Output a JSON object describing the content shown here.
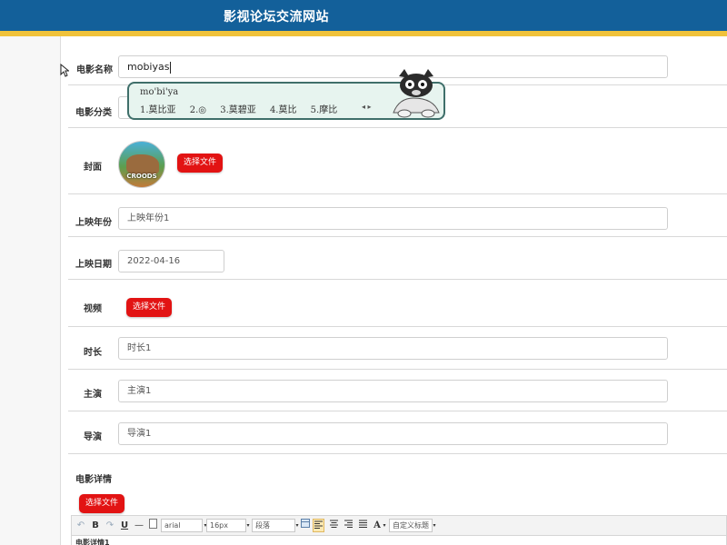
{
  "header": {
    "title": "影视论坛交流网站"
  },
  "form": {
    "movie_name": {
      "label": "电影名称",
      "value": "mobiyas"
    },
    "category": {
      "label": "电影分类"
    },
    "cover": {
      "label": "封面",
      "button": "选择文件",
      "thumb_text": "CROODS"
    },
    "release_year": {
      "label": "上映年份",
      "placeholder": "上映年份1"
    },
    "release_date": {
      "label": "上映日期",
      "value": "2022-04-16"
    },
    "video": {
      "label": "视频",
      "button": "选择文件"
    },
    "duration": {
      "label": "时长",
      "placeholder": "时长1"
    },
    "starring": {
      "label": "主演",
      "placeholder": "主演1"
    },
    "director": {
      "label": "导演",
      "placeholder": "导演1"
    },
    "details": {
      "label": "电影详情",
      "button": "选择文件"
    }
  },
  "ime": {
    "pinyin": "mo'bi'ya",
    "candidates": [
      "1.莫比亚",
      "2.◎",
      "3.莫碧亚",
      "4.莫比",
      "5.摩比"
    ],
    "arrows": "◂ ▸"
  },
  "editor": {
    "toolbar": {
      "undo": "↶",
      "bold": "B",
      "redo": "↷",
      "underline": "U",
      "hr": "—",
      "font_family": "arial",
      "font_size": "16px",
      "paragraph": "段落",
      "font_color": "A",
      "custom_title": "自定义标题"
    },
    "content_preview": "电影详情1"
  },
  "colors": {
    "header": "#13609a",
    "stripe": "#f0c23a",
    "button": "#e21313",
    "ime_bg": "#e7f4ef",
    "ime_border": "#3f6f6a"
  }
}
